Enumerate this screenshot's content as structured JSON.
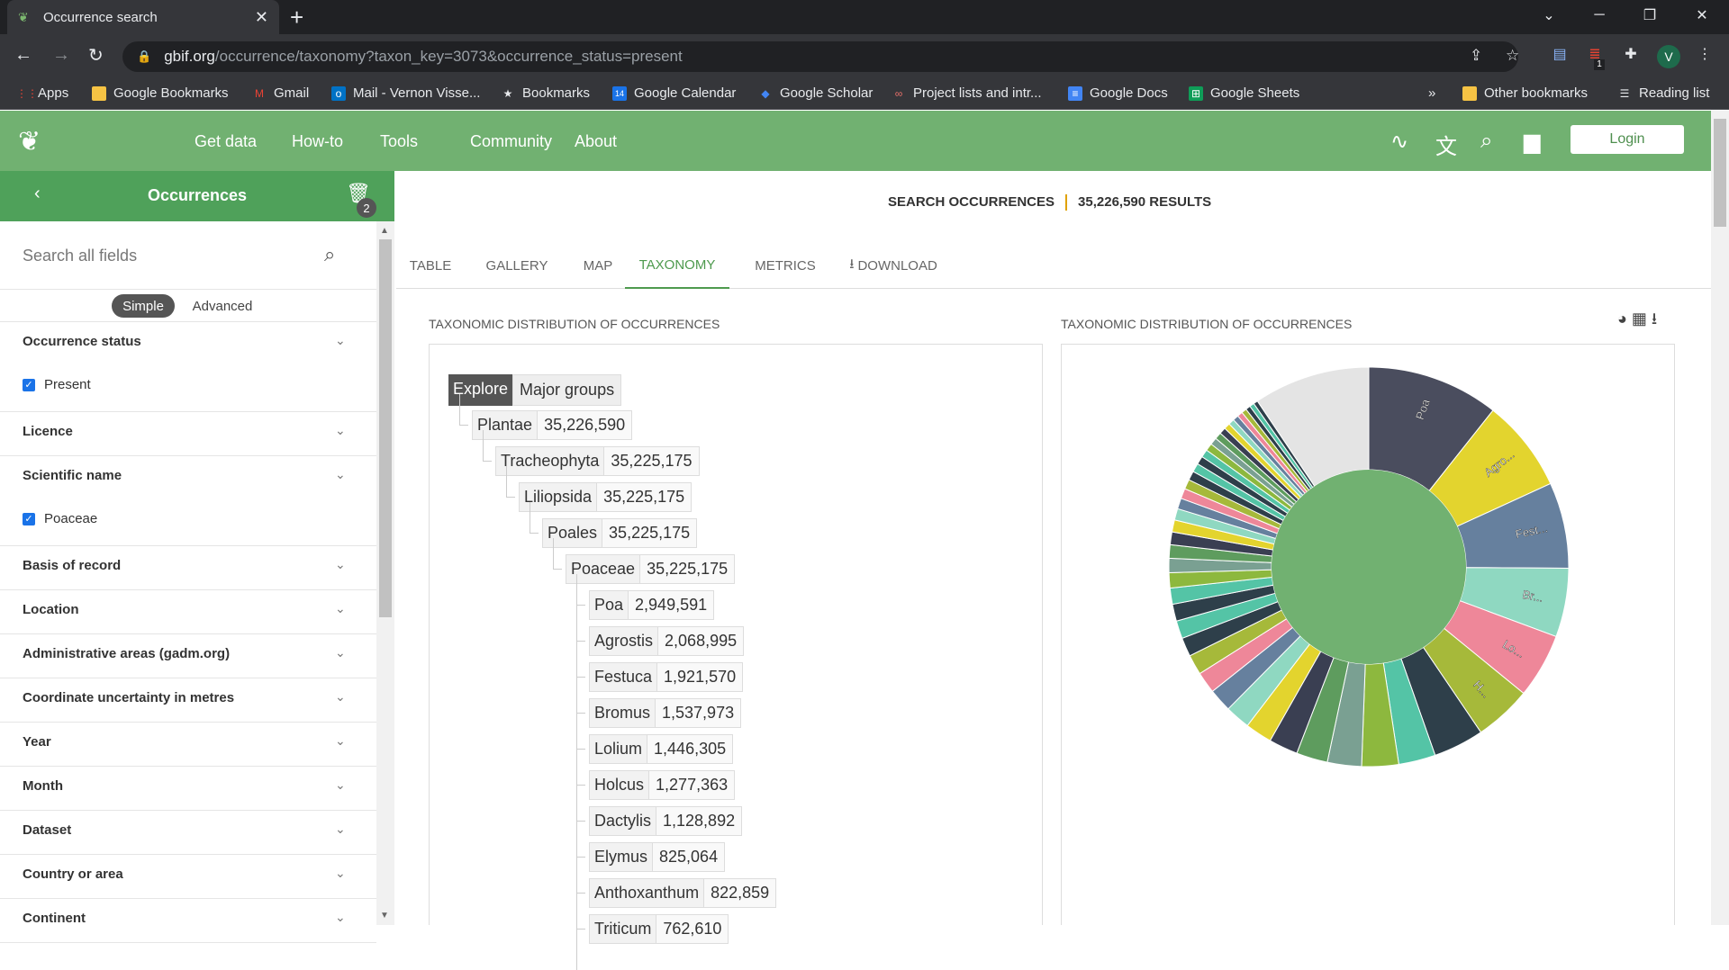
{
  "browser": {
    "tab_title": "Occurrence search",
    "url_host": "gbif.org",
    "url_path": "/occurrence/taxonomy?taxon_key=3073&occurrence_status=present",
    "profile_initial": "V",
    "ext_badge": "1",
    "bookmarks": [
      {
        "label": "Apps",
        "icon": "apps-grid-icon",
        "color": "#ea4335"
      },
      {
        "label": "Google Bookmarks",
        "icon": "folder-icon",
        "color": "#f6c344"
      },
      {
        "label": "Gmail",
        "icon": "gmail-icon",
        "color": "#ea4335"
      },
      {
        "label": "Mail - Vernon Visse...",
        "icon": "outlook-icon",
        "color": "#0072c6"
      },
      {
        "label": "Bookmarks",
        "icon": "star-icon",
        "color": "#e8eaed"
      },
      {
        "label": "Google Calendar",
        "icon": "calendar-icon",
        "color": "#1a73e8"
      },
      {
        "label": "Google Scholar",
        "icon": "scholar-icon",
        "color": "#4285f4"
      },
      {
        "label": "Project lists and intr...",
        "icon": "link-icon",
        "color": "#e8706a"
      },
      {
        "label": "Google Docs",
        "icon": "docs-icon",
        "color": "#4285f4"
      },
      {
        "label": "Google Sheets",
        "icon": "sheets-icon",
        "color": "#0f9d58"
      }
    ],
    "other_bookmarks": "Other bookmarks",
    "reading_list": "Reading list",
    "more": "»"
  },
  "gbif": {
    "nav": [
      "Get data",
      "How-to",
      "Tools",
      "Community",
      "About"
    ],
    "login": "Login"
  },
  "sidebar": {
    "title": "Occurrences",
    "filter_count": "2",
    "search_placeholder": "Search all fields",
    "mode_simple": "Simple",
    "mode_advanced": "Advanced",
    "facets": [
      {
        "label": "Occurrence status",
        "option": "Present"
      },
      {
        "label": "Licence",
        "option": ""
      },
      {
        "label": "Scientific name",
        "option": "Poaceae"
      },
      {
        "label": "Basis of record",
        "option": ""
      },
      {
        "label": "Location",
        "option": ""
      },
      {
        "label": "Administrative areas (gadm.org)",
        "option": ""
      },
      {
        "label": "Coordinate uncertainty in metres",
        "option": ""
      },
      {
        "label": "Year",
        "option": ""
      },
      {
        "label": "Month",
        "option": ""
      },
      {
        "label": "Dataset",
        "option": ""
      },
      {
        "label": "Country or area",
        "option": ""
      },
      {
        "label": "Continent",
        "option": ""
      }
    ]
  },
  "main": {
    "search_label": "SEARCH OCCURRENCES",
    "results": "35,226,590 RESULTS",
    "tabs": [
      "TABLE",
      "GALLERY",
      "MAP",
      "TAXONOMY",
      "METRICS",
      "DOWNLOAD"
    ],
    "active_tab": "TAXONOMY",
    "left_title": "TAXONOMIC DISTRIBUTION OF OCCURRENCES",
    "right_title": "TAXONOMIC DISTRIBUTION OF OCCURRENCES",
    "tree_explore": "Explore",
    "tree_major": "Major groups",
    "tree": [
      {
        "name": "Plantae",
        "count": "35,226,590",
        "depth": 0
      },
      {
        "name": "Tracheophyta",
        "count": "35,225,175",
        "depth": 1
      },
      {
        "name": "Liliopsida",
        "count": "35,225,175",
        "depth": 2
      },
      {
        "name": "Poales",
        "count": "35,225,175",
        "depth": 3
      },
      {
        "name": "Poaceae",
        "count": "35,225,175",
        "depth": 4
      },
      {
        "name": "Poa",
        "count": "2,949,591",
        "depth": 5
      },
      {
        "name": "Agrostis",
        "count": "2,068,995",
        "depth": 5
      },
      {
        "name": "Festuca",
        "count": "1,921,570",
        "depth": 5
      },
      {
        "name": "Bromus",
        "count": "1,537,973",
        "depth": 5
      },
      {
        "name": "Lolium",
        "count": "1,446,305",
        "depth": 5
      },
      {
        "name": "Holcus",
        "count": "1,277,363",
        "depth": 5
      },
      {
        "name": "Dactylis",
        "count": "1,128,892",
        "depth": 5
      },
      {
        "name": "Elymus",
        "count": "825,064",
        "depth": 5
      },
      {
        "name": "Anthoxanthum",
        "count": "822,859",
        "depth": 5
      },
      {
        "name": "Triticum",
        "count": "762,610",
        "depth": 5
      }
    ]
  },
  "chart_data": {
    "type": "pie",
    "title": "",
    "center_color": "#71b171",
    "labeled_slices": [
      {
        "label": "Poa",
        "value": 2949591,
        "color": "#4a4d5e"
      },
      {
        "label": "Agro...",
        "value": 2068995,
        "color": "#e3d42e"
      },
      {
        "label": "Fest...",
        "value": 1921570,
        "color": "#66809e"
      },
      {
        "label": "Br...",
        "value": 1537973,
        "color": "#8fd8c1"
      },
      {
        "label": "Lo...",
        "value": 1446305,
        "color": "#ee8799"
      },
      {
        "label": "H...",
        "value": 1277363,
        "color": "#a6b93a"
      }
    ],
    "other_slice_values": [
      1128892,
      825064,
      822859,
      762610,
      700000,
      650000,
      600000,
      560000,
      520000,
      480000,
      450000,
      420000,
      400000,
      380000,
      360000,
      340000,
      320000,
      300000,
      285000,
      270000,
      255000,
      240000,
      228000,
      216000,
      205000,
      195000,
      185000,
      176000,
      168000,
      160000,
      152000,
      145000,
      138000,
      132000,
      126000,
      120000,
      114000,
      108000,
      103000,
      98000
    ],
    "other_colors": [
      "#2e3f4a",
      "#54c4a6",
      "#8db83e",
      "#7aa092",
      "#5e9c5e",
      "#3a3f52",
      "#e3d42e",
      "#8fd8c1",
      "#66809e",
      "#ee8799",
      "#a6b93a",
      "#2e3f4a",
      "#54c4a6"
    ],
    "remainder_value": 2600000,
    "remainder_color": "#e4e4e4"
  }
}
